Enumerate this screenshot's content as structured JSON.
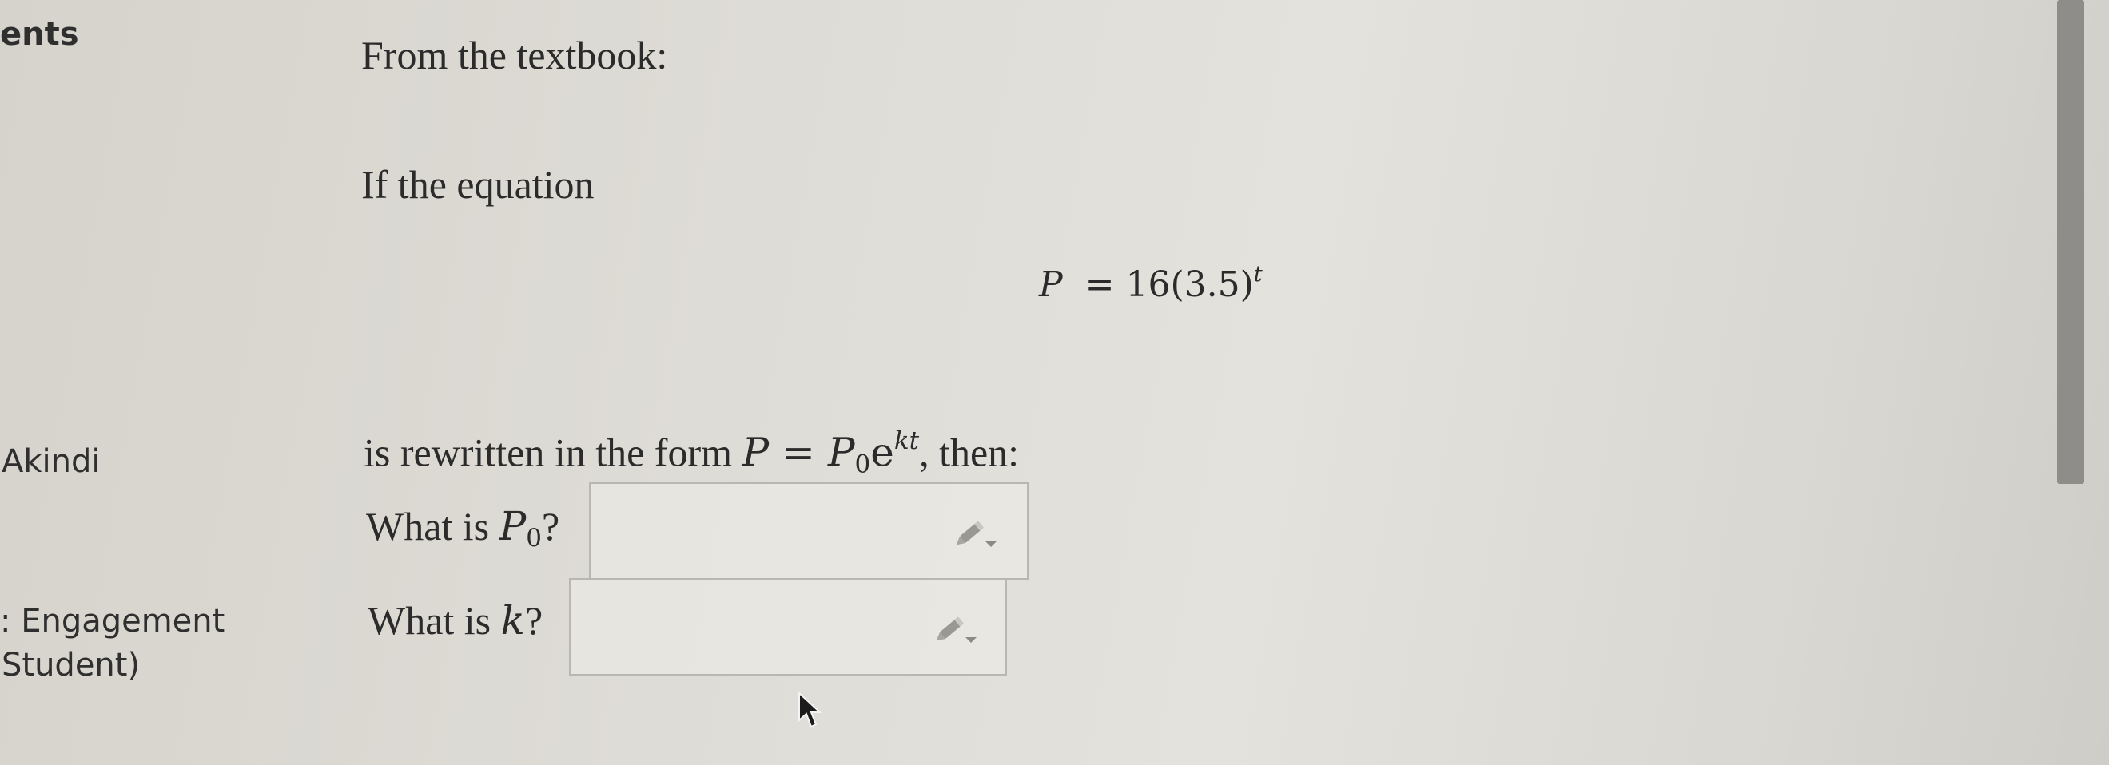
{
  "sidebar": {
    "heading_partial": "ents",
    "name_partial": "Akindi",
    "engagement_line1": ": Engagement",
    "engagement_line2": "Student)"
  },
  "question": {
    "intro": "From the textbook:",
    "if_line": "If the equation",
    "equation": {
      "lhs": "P",
      "equals": "=",
      "coefficient": "16(3.5)",
      "exponent": "t"
    },
    "rewritten_line": {
      "prefix": "is rewritten in the form ",
      "P": "P",
      "equals": " = ",
      "P0": "P",
      "P0_sub": "0",
      "e": "e",
      "exponent": "kt",
      "suffix": ", then:"
    },
    "prompt_p0": {
      "prefix": "What is ",
      "var": "P",
      "sub": "0",
      "suffix": "?"
    },
    "prompt_k": {
      "prefix": "What is ",
      "var": "k",
      "suffix": "?"
    }
  },
  "answers": {
    "p0_value": "",
    "k_value": ""
  },
  "icons": {
    "answer_tool": "pencil-dropdown-icon",
    "cursor": "mouse-pointer-icon"
  },
  "colors": {
    "background": "#dedcd6",
    "text": "#2b2b2b",
    "box_border": "#b9b7b1",
    "scrollbar_thumb": "#8e8d89"
  }
}
